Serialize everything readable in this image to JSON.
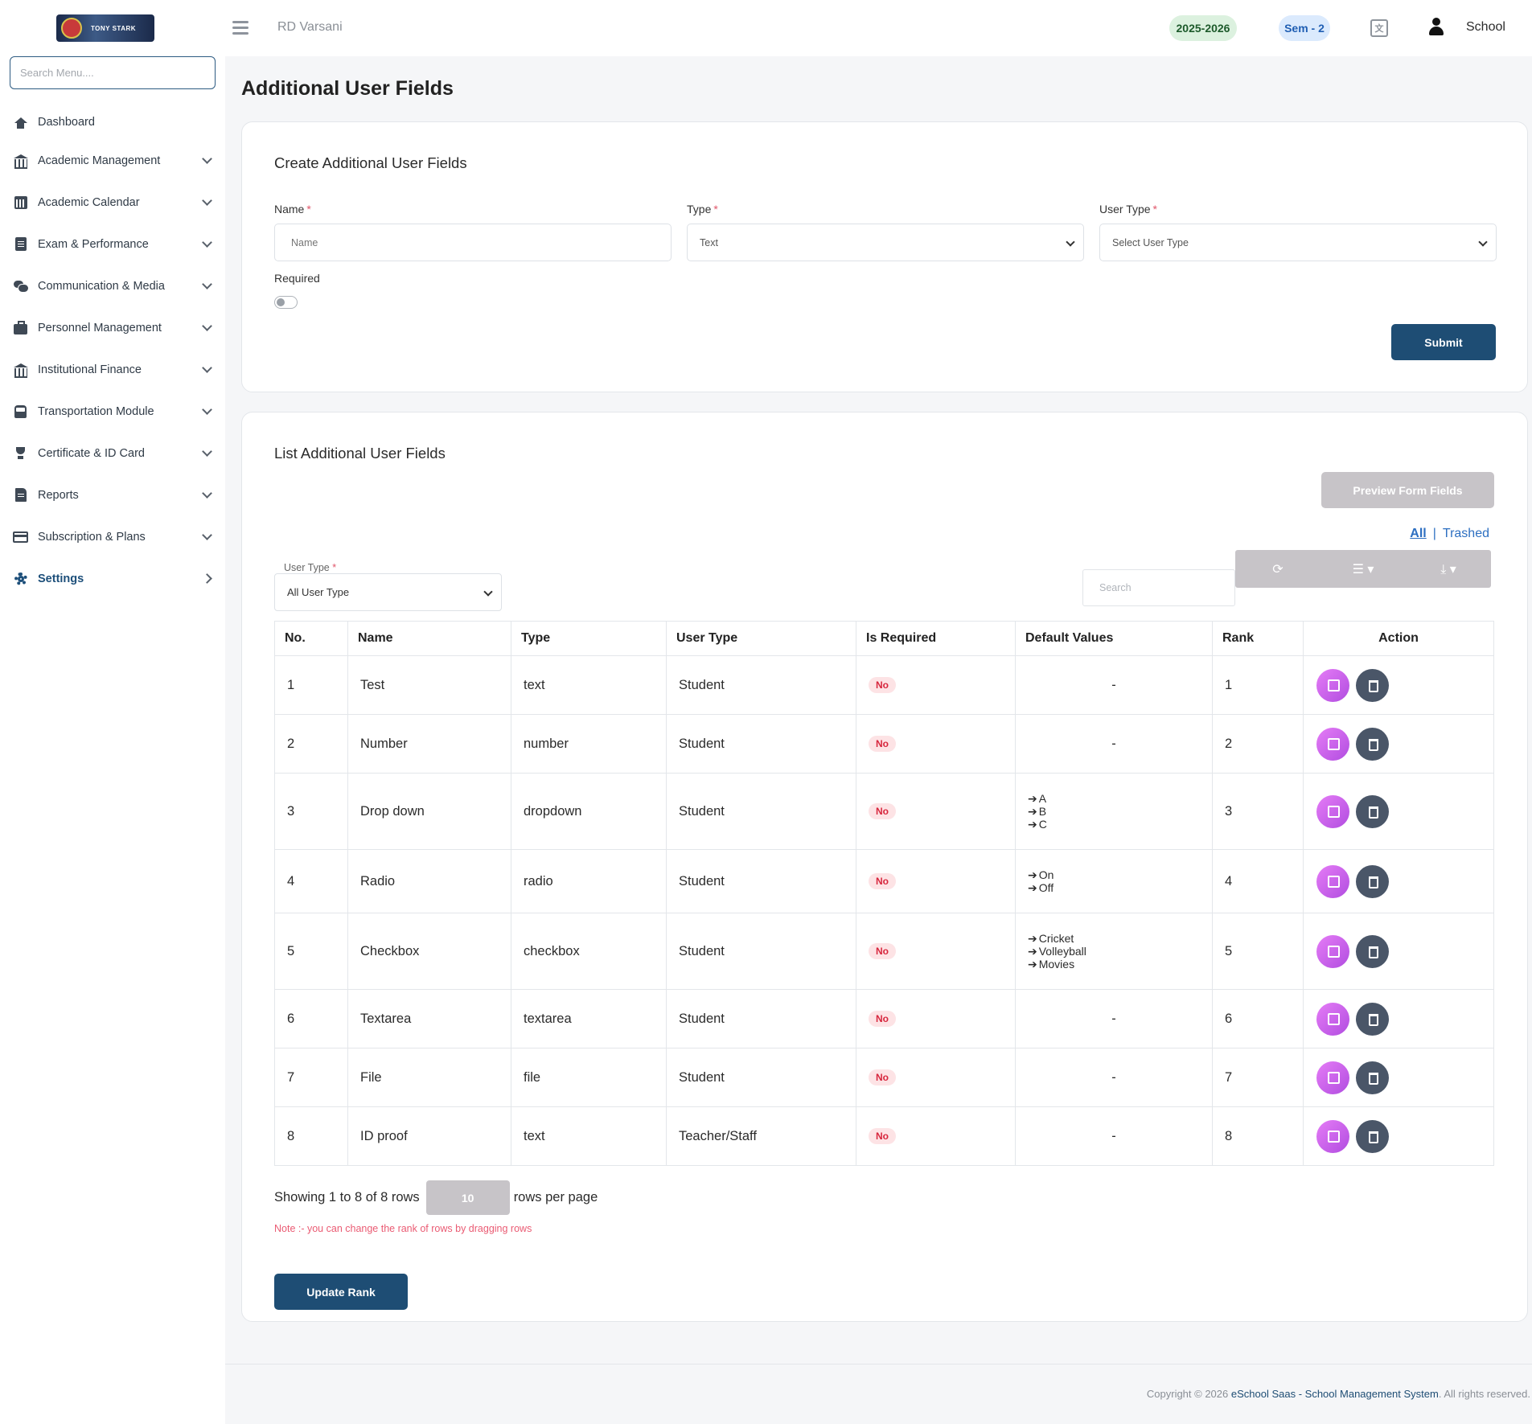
{
  "header": {
    "school_name": "RD Varsani",
    "session": "2025-2026",
    "semester": "Sem - 2",
    "user_label": "School",
    "logo_text": "TONY STARK"
  },
  "sidebar": {
    "search_placeholder": "Search Menu....",
    "items": [
      {
        "label": "Dashboard",
        "icon": "home-icon"
      },
      {
        "label": "Academic Management",
        "icon": "bank-icon"
      },
      {
        "label": "Academic Calendar",
        "icon": "calendar-icon"
      },
      {
        "label": "Exam & Performance",
        "icon": "document-icon"
      },
      {
        "label": "Communication & Media",
        "icon": "chat-icon"
      },
      {
        "label": "Personnel Management",
        "icon": "briefcase-icon"
      },
      {
        "label": "Institutional Finance",
        "icon": "bank-icon"
      },
      {
        "label": "Transportation Module",
        "icon": "bus-icon"
      },
      {
        "label": "Certificate & ID Card",
        "icon": "trophy-icon"
      },
      {
        "label": "Reports",
        "icon": "file-icon"
      },
      {
        "label": "Subscription & Plans",
        "icon": "credit-card-icon"
      },
      {
        "label": "Settings",
        "icon": "gear-icon"
      }
    ]
  },
  "page": {
    "title": "Additional User Fields"
  },
  "create_form": {
    "title": "Create Additional User Fields",
    "name_label": "Name",
    "name_placeholder": "Name",
    "type_label": "Type",
    "type_value": "Text",
    "user_type_label": "User Type",
    "user_type_value": "Select User Type",
    "required_label": "Required",
    "required_on": false,
    "submit_label": "Submit",
    "required_marker": "*"
  },
  "list": {
    "title": "List Additional User Fields",
    "preview_button": "Preview Form Fields",
    "filter_all": "All",
    "filter_sep": "|",
    "filter_trashed": "Trashed",
    "user_type_filter_label": "User Type",
    "user_type_filter_value": "All User Type",
    "search_placeholder": "Search",
    "columns": [
      "No.",
      "Name",
      "Type",
      "User Type",
      "Is Required",
      "Default Values",
      "Rank",
      "Action"
    ],
    "rows": [
      {
        "no": "1",
        "name": "Test",
        "type": "text",
        "user_type": "Student",
        "required": "No",
        "defaults": [],
        "rank": "1"
      },
      {
        "no": "2",
        "name": "Number",
        "type": "number",
        "user_type": "Student",
        "required": "No",
        "defaults": [],
        "rank": "2"
      },
      {
        "no": "3",
        "name": "Drop down",
        "type": "dropdown",
        "user_type": "Student",
        "required": "No",
        "defaults": [
          "A",
          "B",
          "C"
        ],
        "rank": "3"
      },
      {
        "no": "4",
        "name": "Radio",
        "type": "radio",
        "user_type": "Student",
        "required": "No",
        "defaults": [
          "On",
          "Off"
        ],
        "rank": "4"
      },
      {
        "no": "5",
        "name": "Checkbox",
        "type": "checkbox",
        "user_type": "Student",
        "required": "No",
        "defaults": [
          "Cricket",
          "Volleyball",
          "Movies"
        ],
        "rank": "5"
      },
      {
        "no": "6",
        "name": "Textarea",
        "type": "textarea",
        "user_type": "Student",
        "required": "No",
        "defaults": [],
        "rank": "6"
      },
      {
        "no": "7",
        "name": "File",
        "type": "file",
        "user_type": "Student",
        "required": "No",
        "defaults": [],
        "rank": "7"
      },
      {
        "no": "8",
        "name": "ID proof",
        "type": "text",
        "user_type": "Teacher/Staff",
        "required": "No",
        "defaults": [],
        "rank": "8"
      }
    ],
    "empty_default": "-",
    "showing_text": "Showing 1 to 8 of 8 rows",
    "page_size": "10",
    "rows_per_page_text": "rows per page",
    "note": "Note :- you can change the rank of rows by dragging rows",
    "update_rank_button": "Update Rank"
  },
  "footer": {
    "prefix": "Copyright © 2026 ",
    "brand": "eSchool Saas - School Management System",
    "suffix": ". All rights reserved."
  },
  "colors": {
    "primary": "#1e4d74",
    "edit_button": "#c45be8",
    "delete_button": "#4a5668",
    "badge_no_bg": "#fde3e5",
    "badge_no_text": "#d7263d"
  }
}
